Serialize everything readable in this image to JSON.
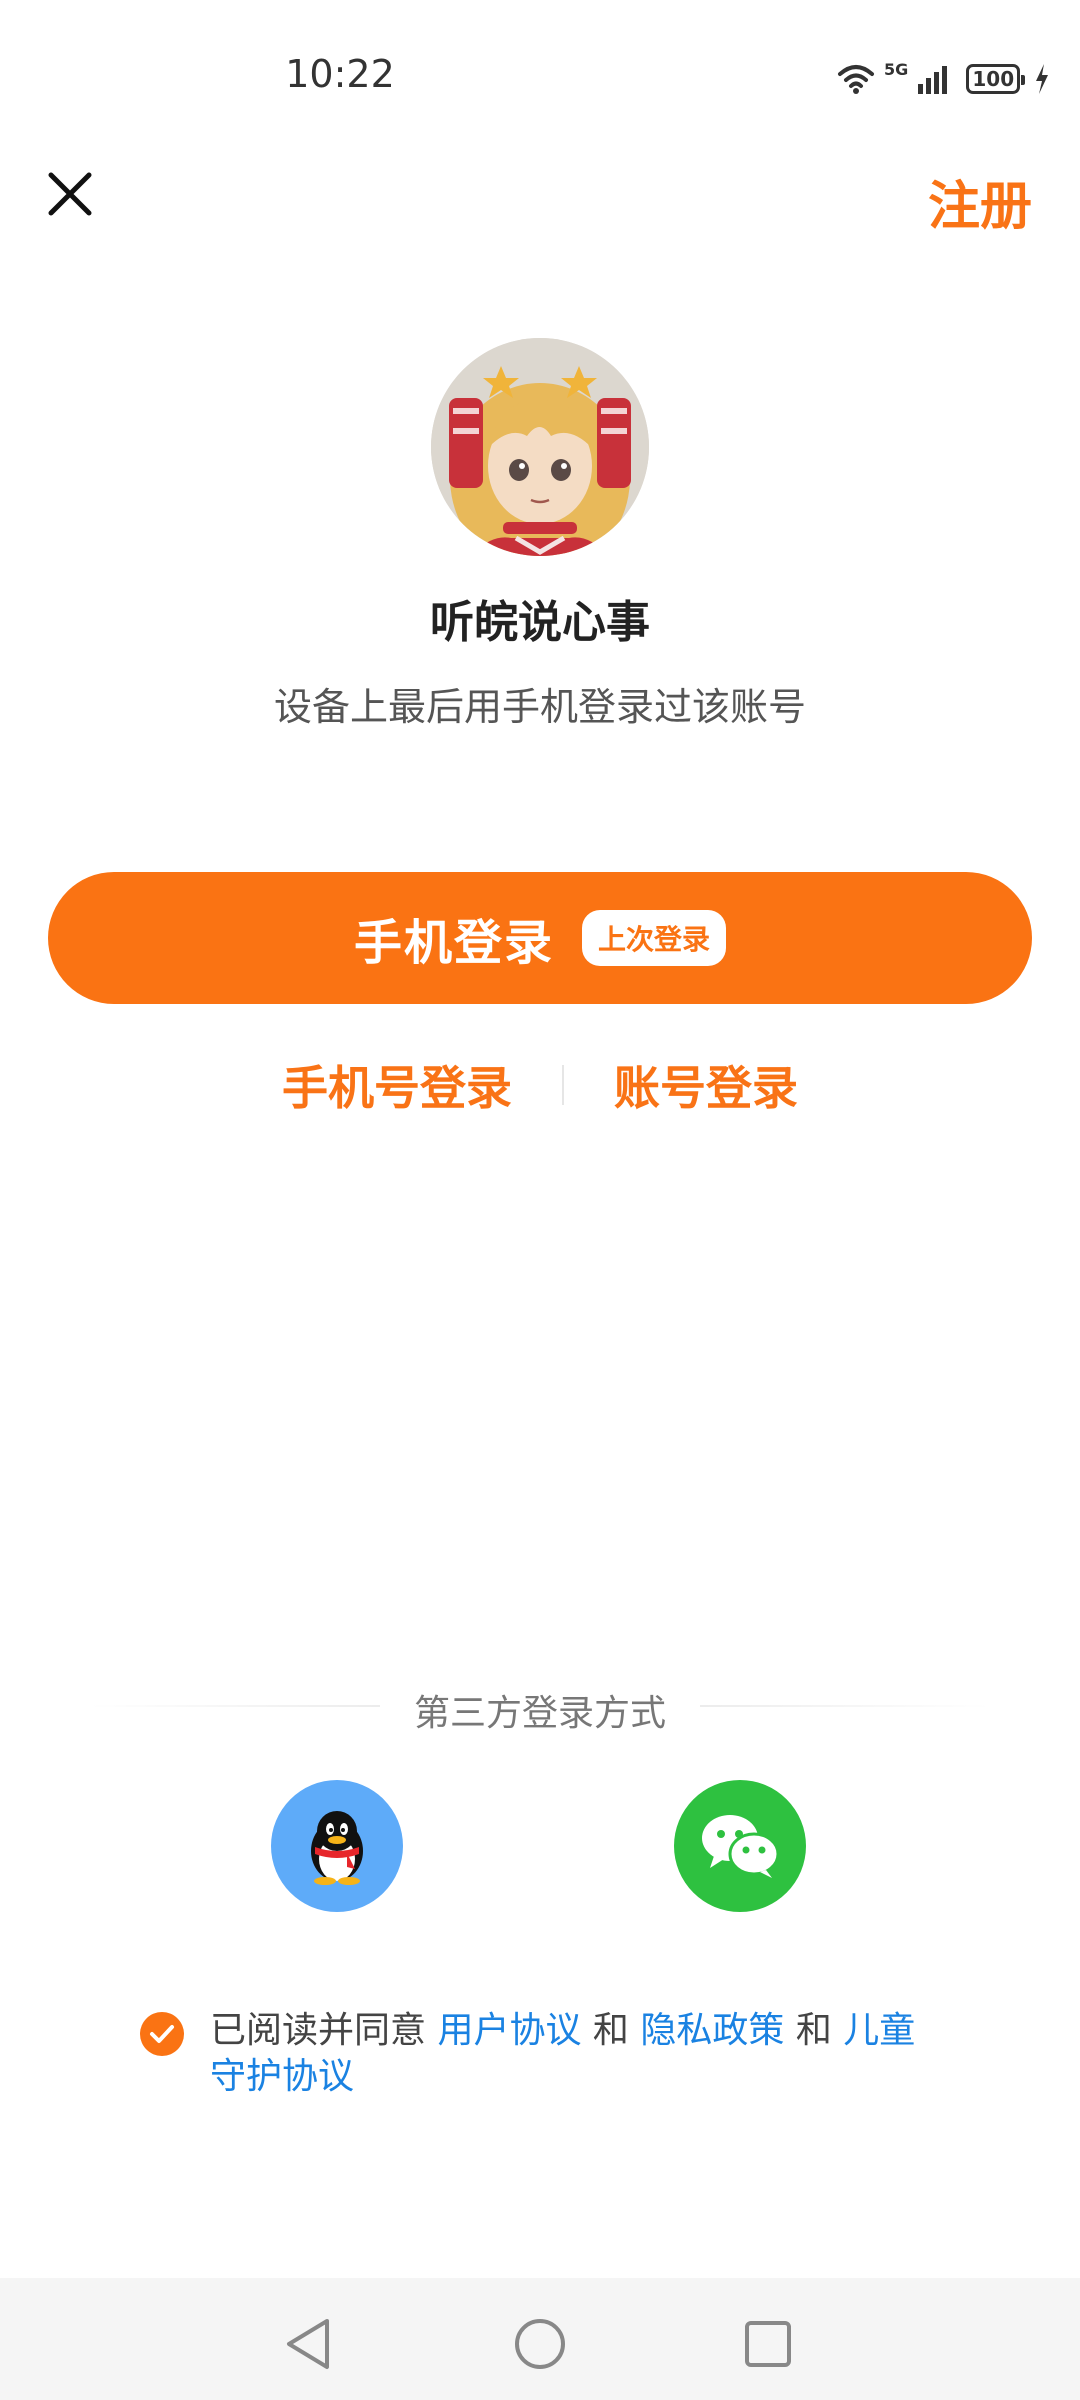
{
  "status_bar": {
    "time": "10:22",
    "network": "5G",
    "battery": "100"
  },
  "header": {
    "close_icon": "close-icon",
    "register_label": "注册"
  },
  "profile": {
    "avatar_icon": "avatar-illustration",
    "name": "听皖说心事",
    "hint": "设备上最后用手机登录过该账号"
  },
  "login": {
    "primary_label": "手机登录",
    "last_used_badge": "上次登录",
    "phone_number_login": "手机号登录",
    "account_login": "账号登录"
  },
  "third_party": {
    "title": "第三方登录方式",
    "qq_icon": "qq-penguin-icon",
    "wechat_icon": "wechat-icon"
  },
  "agreement": {
    "prefix": "已阅读并同意 ",
    "user_agreement": "用户协议",
    "and1": " 和 ",
    "privacy_policy": "隐私政策",
    "and2": " 和 ",
    "child_protection": "儿童守护协议",
    "checked": true
  },
  "colors": {
    "accent": "#fa7313",
    "link": "#1a82e2",
    "qq": "#5eabf9",
    "wechat": "#2ec140"
  }
}
